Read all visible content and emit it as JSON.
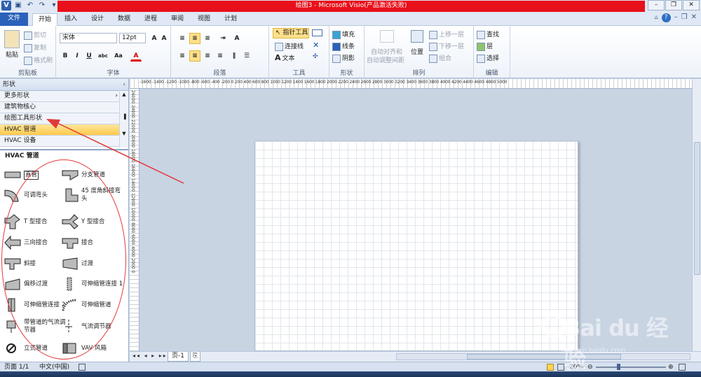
{
  "window": {
    "title": "绘图3 - Microsoft Visio(产品激活失败)"
  },
  "tabs": [
    "文件",
    "开始",
    "插入",
    "设计",
    "数据",
    "进程",
    "审阅",
    "视图",
    "计划"
  ],
  "ribbon": {
    "clipboard": {
      "paste": "粘贴",
      "cut": "剪切",
      "copy": "复制",
      "format_painter": "格式刷",
      "label": "剪贴板"
    },
    "font": {
      "name": "宋体",
      "size": "12pt",
      "label": "字体"
    },
    "paragraph": {
      "label": "段落"
    },
    "tools": {
      "pointer": "指针工具",
      "connector": "连接线",
      "text": "文本",
      "label": "工具"
    },
    "shape": {
      "fill": "填充",
      "line": "线条",
      "shadow": "阴影",
      "label": "形状"
    },
    "arrange": {
      "auto_align": "自动对齐和",
      "auto_space": "自动调整间距",
      "position": "位置",
      "bring_forward": "上移一层",
      "send_backward": "下移一层",
      "group": "组合",
      "label": "排列"
    },
    "editing": {
      "find": "查找",
      "layers": "层",
      "select": "选择",
      "label": "编辑"
    }
  },
  "shapes_pane": {
    "header": "形状",
    "stencils": [
      {
        "label": "更多形状",
        "selected": false
      },
      {
        "label": "建筑物核心",
        "selected": false
      },
      {
        "label": "绘图工具形状",
        "selected": false
      },
      {
        "label": "HVAC 管道",
        "selected": true
      },
      {
        "label": "HVAC 设备",
        "selected": false
      }
    ],
    "shapes_title": "HVAC 管道",
    "shapes": [
      {
        "label": "直管",
        "icon": "straight-duct-icon"
      },
      {
        "label": "分支管道",
        "icon": "branch-duct-icon"
      },
      {
        "label": "可调弯头",
        "icon": "adjustable-elbow-icon"
      },
      {
        "label": "45 度角斜接弯头",
        "icon": "miter-elbow-45-icon"
      },
      {
        "label": "T 型接合",
        "icon": "tee-junction-icon"
      },
      {
        "label": "Y 型接合",
        "icon": "wye-junction-icon"
      },
      {
        "label": "三向接合",
        "icon": "three-way-junction-icon"
      },
      {
        "label": "接合",
        "icon": "junction-icon"
      },
      {
        "label": "斜接",
        "icon": "miter-icon"
      },
      {
        "label": "过渡",
        "icon": "transition-icon"
      },
      {
        "label": "偏移过渡",
        "icon": "offset-transition-icon"
      },
      {
        "label": "可伸缩管连接 1",
        "icon": "flex-duct-connection-1-icon"
      },
      {
        "label": "可伸缩管连接 2",
        "icon": "flex-duct-connection-2-icon"
      },
      {
        "label": "可伸缩管道",
        "icon": "flexible-duct-icon"
      },
      {
        "label": "带管道的气流调节器",
        "icon": "damper-with-duct-icon"
      },
      {
        "label": "气流调节器",
        "icon": "damper-icon"
      },
      {
        "label": "立式管道",
        "icon": "riser-icon"
      },
      {
        "label": "VAV 风箱",
        "icon": "vav-box-icon"
      }
    ]
  },
  "rulers": {
    "horizontal": "-1600 -1400 -1200 -1000 -800 -600 -400 -200 0 200 400 600 800 1000 1200 1400 1600 1800 2000 2200 2400 2600 2800 3000 3200 3400 3600 3800 4000 4200 4400 4600 4800 5000",
    "vertical": "26000 24000 22000 20000 18000 16000 14000 12000 10000 8000 6000 4000 2000 0"
  },
  "page_tabs": {
    "current": "页-1"
  },
  "status": {
    "page": "页面 1/1",
    "language": "中文(中国)",
    "zoom": "20%"
  },
  "watermark": {
    "brand": "Bai du 经验",
    "url": "jingyan.baidu.com"
  },
  "colors": {
    "title_red": "#e8101a",
    "file_tab": "#2a62b9",
    "selected_stencil": "#ffc94d",
    "annotation": "#e23a3a"
  }
}
